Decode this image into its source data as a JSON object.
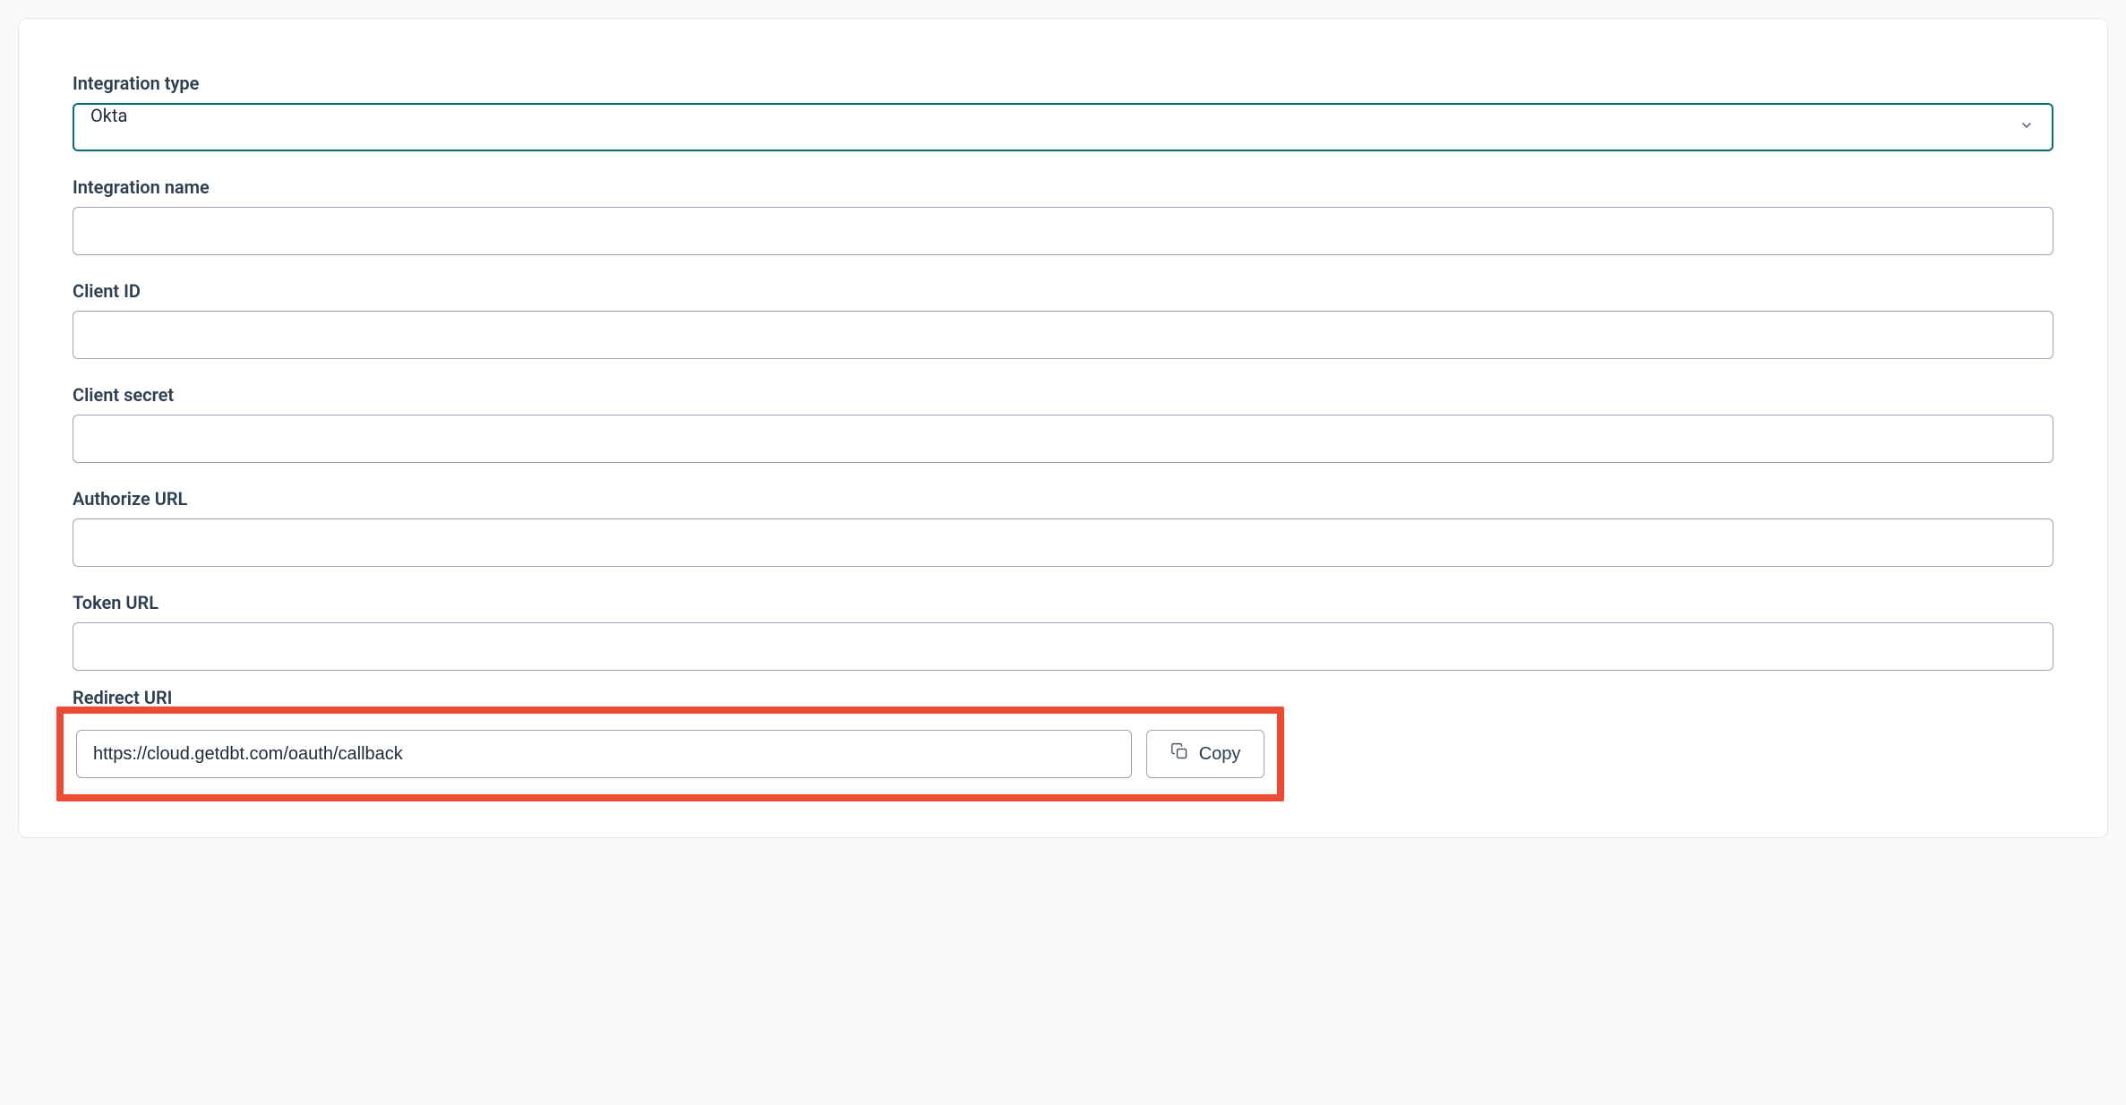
{
  "form": {
    "integration_type": {
      "label": "Integration type",
      "value": "Okta"
    },
    "integration_name": {
      "label": "Integration name",
      "value": ""
    },
    "client_id": {
      "label": "Client ID",
      "value": ""
    },
    "client_secret": {
      "label": "Client secret",
      "value": ""
    },
    "authorize_url": {
      "label": "Authorize URL",
      "value": ""
    },
    "token_url": {
      "label": "Token URL",
      "value": ""
    },
    "redirect_uri": {
      "label": "Redirect URI",
      "value": "https://cloud.getdbt.com/oauth/callback",
      "copy_label": "Copy"
    }
  }
}
